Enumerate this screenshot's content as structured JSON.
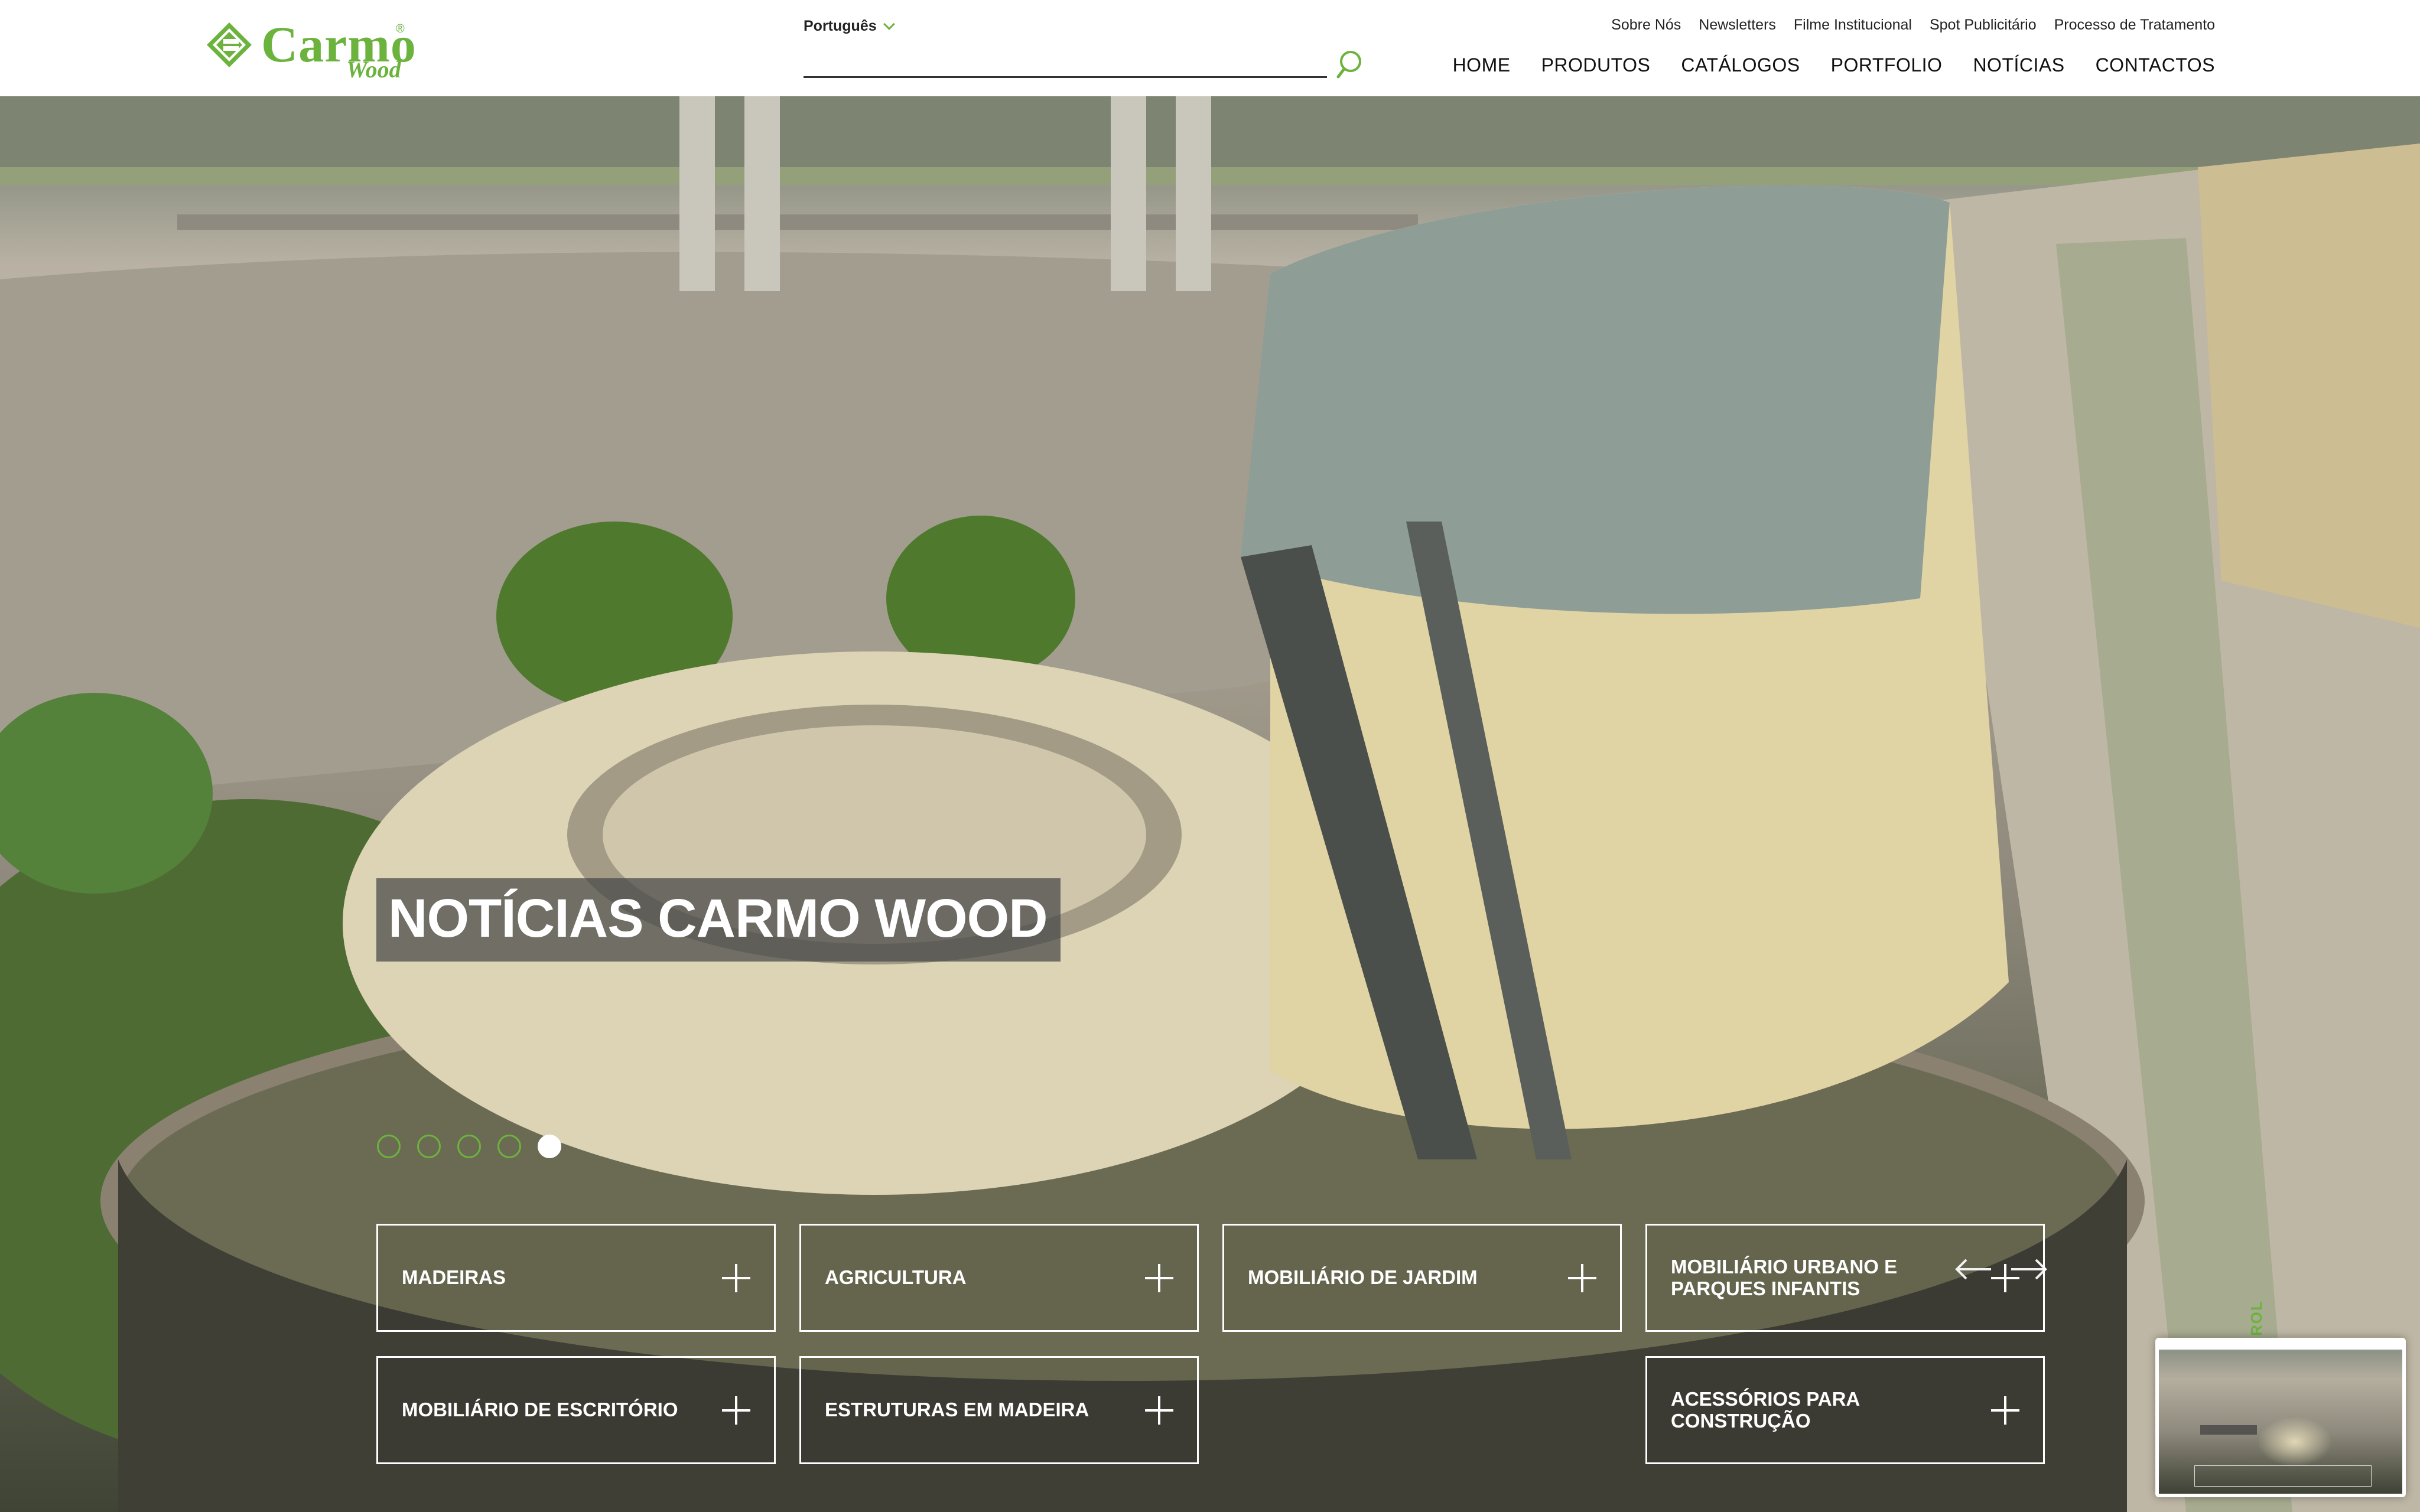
{
  "brand": {
    "name": "Carmo",
    "sub": "Wood",
    "reg": "®",
    "color": "#6cb33e"
  },
  "language": {
    "selected": "Português"
  },
  "search": {
    "placeholder": ""
  },
  "top_links": [
    "Sobre Nós",
    "Newsletters",
    "Filme Institucional",
    "Spot Publicitário",
    "Processo de Tratamento"
  ],
  "main_nav": [
    "HOME",
    "PRODUTOS",
    "CATÁLOGOS",
    "PORTFOLIO",
    "NOTÍCIAS",
    "CONTACTOS"
  ],
  "hero": {
    "title": "NOTÍCIAS CARMO WOOD",
    "slides_total": 5,
    "active_slide": 5
  },
  "categories": [
    "MADEIRAS",
    "AGRICULTURA",
    "MOBILIÁRIO DE JARDIM",
    "MOBILIÁRIO URBANO E\nPARQUES INFANTIS",
    "MOBILIÁRIO DE ESCRITÓRIO",
    "ESTRUTURAS EM MADEIRA",
    "ACESSÓRIOS PARA\nCONSTRUÇÃO"
  ],
  "scroll_label": "ROLL",
  "icons": {
    "search": "search-icon",
    "chevron": "chevron-down-icon",
    "prev": "arrow-left-icon",
    "next": "arrow-right-icon",
    "plus": "plus-icon"
  }
}
